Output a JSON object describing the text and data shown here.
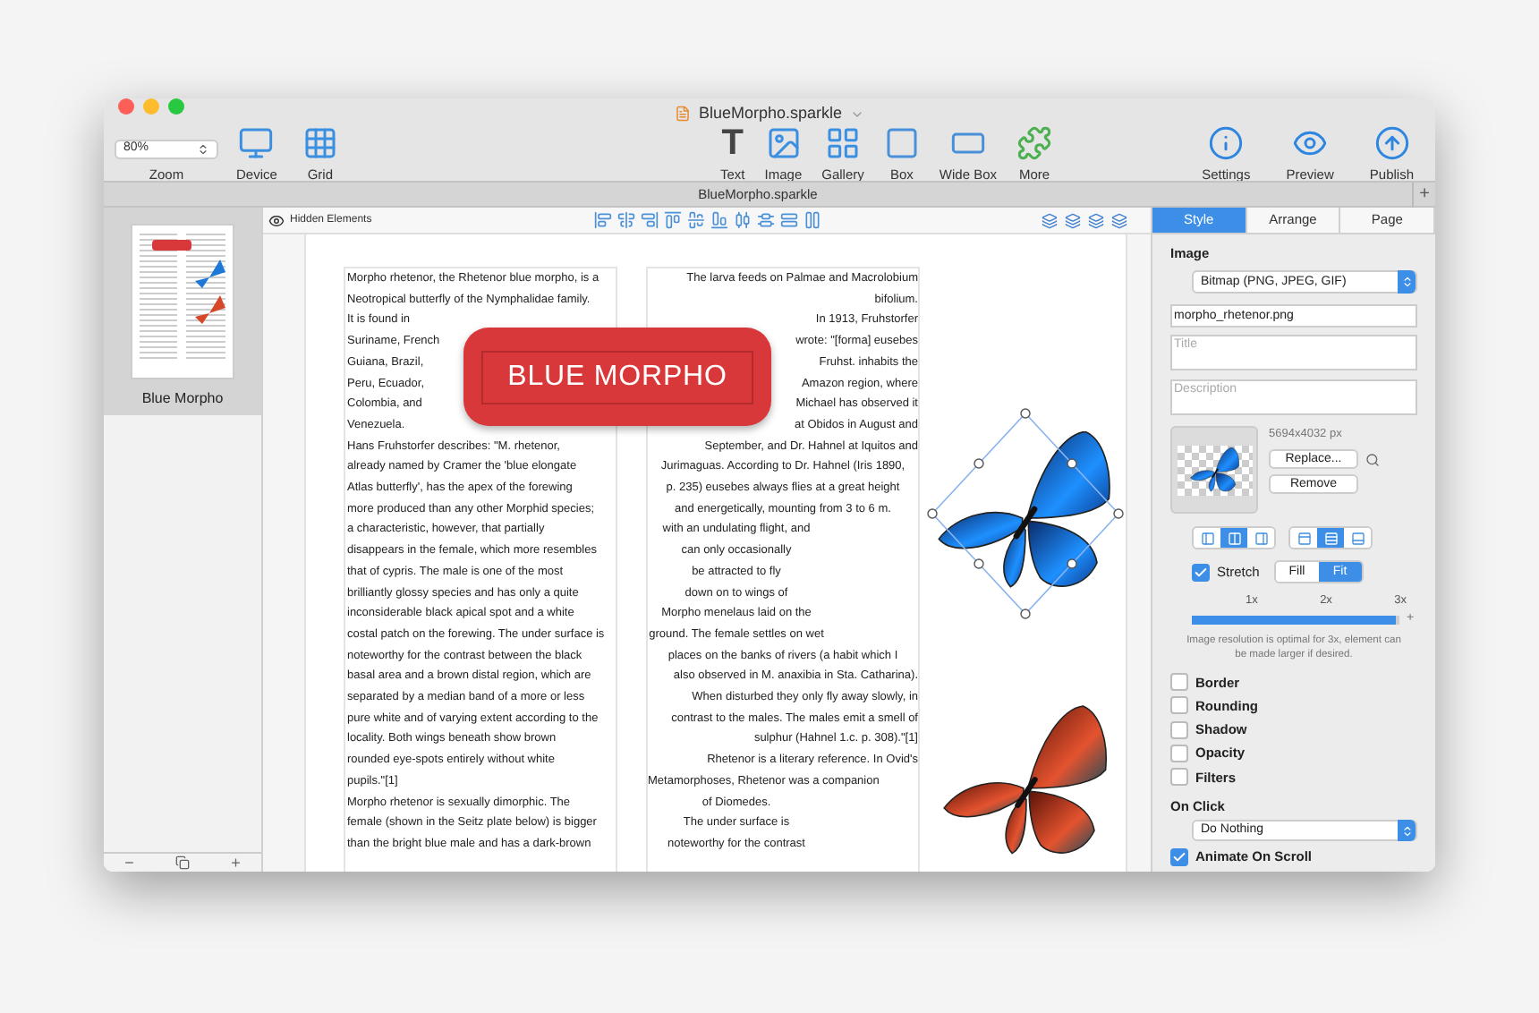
{
  "window": {
    "title": "BlueMorpho.sparkle"
  },
  "toolbar": {
    "zoom": {
      "value": "80%",
      "label": "Zoom"
    },
    "left": [
      {
        "kind": "device",
        "label": "Device"
      },
      {
        "kind": "grid",
        "label": "Grid"
      }
    ],
    "center": [
      {
        "kind": "text",
        "label": "Text",
        "glyph": "T"
      },
      {
        "kind": "image",
        "label": "Image"
      },
      {
        "kind": "gallery",
        "label": "Gallery"
      },
      {
        "kind": "box",
        "label": "Box"
      },
      {
        "kind": "widebox",
        "label": "Wide Box"
      },
      {
        "kind": "more",
        "label": "More"
      }
    ],
    "right": [
      {
        "kind": "settings",
        "label": "Settings"
      },
      {
        "kind": "preview",
        "label": "Preview"
      },
      {
        "kind": "publish",
        "label": "Publish"
      }
    ]
  },
  "document_tab": {
    "label": "BlueMorpho.sparkle",
    "add": "+"
  },
  "sidebar": {
    "pages": [
      {
        "label": "Blue Morpho",
        "selected": true
      }
    ],
    "remove": "−",
    "add": "+"
  },
  "canvas_toolbar": {
    "hidden_elements": "Hidden Elements"
  },
  "page": {
    "banner": "BLUE MORPHO",
    "column_1": [
      "Morpho rhetenor, the Rhetenor blue morpho, is a",
      "Neotropical butterfly of the Nymphalidae family.",
      "It is found in",
      "Suriname, French",
      "Guiana, Brazil,",
      "Peru, Ecuador,",
      "Colombia, and",
      "Venezuela.",
      "Hans Fruhstorfer describes: \"M. rhetenor,",
      "already named by Cramer the 'blue elongate",
      "Atlas butterfly', has the apex of the forewing",
      "more produced than any other Morphid species;",
      "a characteristic, however, that partially",
      "disappears in the female, which more resembles",
      "that of cypris. The male is one of the most",
      "brilliantly glossy species and has only a quite",
      "inconsiderable black apical spot and a white",
      "costal patch on the forewing. The under surface is",
      "noteworthy for the contrast between the black",
      "basal area and a brown distal region, which are",
      "separated by a median band of a more or less",
      "pure white and of varying extent according to the",
      "locality. Both wings beneath show brown",
      "rounded eye-spots entirely without white",
      "pupils.\"[1]",
      "Morpho rhetenor is sexually dimorphic. The",
      "female (shown in the Seitz plate below) is bigger",
      "than the bright blue male and has a dark-brown"
    ],
    "column_2": [
      {
        "text": "The larva feeds on Palmae and Macrolobium",
        "kind": "right"
      },
      {
        "text": "bifolium.",
        "kind": "right"
      },
      {
        "text": "In 1913, Fruhstorfer",
        "kind": "right"
      },
      {
        "text": "wrote: \"[forma] eusebes",
        "kind": "right"
      },
      {
        "text": "Fruhst. inhabits the",
        "kind": "right"
      },
      {
        "text": "Amazon region, where",
        "kind": "right"
      },
      {
        "text": "Michael has observed it",
        "kind": "right"
      },
      {
        "text": "at Obidos in August and",
        "kind": "right"
      },
      {
        "text": "September, and Dr. Hahnel at Iquitos and",
        "kind": "right"
      },
      {
        "text": "Jurimaguas. According to Dr. Hahnel (Iris 1890,",
        "kind": "center"
      },
      {
        "text": "p. 235) eusebes always flies at a great height",
        "kind": "center"
      },
      {
        "text": "and energetically, mounting from 3 to 6 m.",
        "kind": "center"
      },
      {
        "text": "with an undulating flight, and",
        "kind": "wrap"
      },
      {
        "text": "can only occasionally",
        "kind": "wrap"
      },
      {
        "text": "be attracted to fly",
        "kind": "wrap"
      },
      {
        "text": "down on to wings of",
        "kind": "wrap"
      },
      {
        "text": "Morpho menelaus laid on the",
        "kind": "wrap"
      },
      {
        "text": "ground. The female settles on wet",
        "kind": "wrap"
      },
      {
        "text": "places on the banks of rivers (a habit which I",
        "kind": "center"
      },
      {
        "text": "also observed in M. anaxibia in Sta. Catharina).",
        "kind": "right"
      },
      {
        "text": "When disturbed they only fly away slowly, in",
        "kind": "right"
      },
      {
        "text": "contrast to the males. The males emit a smell of",
        "kind": "right"
      },
      {
        "text": "sulphur (Hahnel 1.c. p. 308).\"[1]",
        "kind": "right"
      },
      {
        "text": "Rhetenor is a literary reference. In Ovid's",
        "kind": "right"
      },
      {
        "text": "Metamorphoses, Rhetenor was a companion",
        "kind": "wrap"
      },
      {
        "text": "of Diomedes.",
        "kind": "wrap"
      },
      {
        "text": "The under surface is",
        "kind": "wrap"
      },
      {
        "text": "noteworthy for the contrast",
        "kind": "wrap"
      }
    ]
  },
  "inspector": {
    "tabs": [
      {
        "label": "Style",
        "selected": true
      },
      {
        "label": "Arrange",
        "selected": false
      },
      {
        "label": "Page",
        "selected": false
      }
    ],
    "section": "Image",
    "type_select": "Bitmap (PNG, JPEG, GIF)",
    "file_name": "morpho_rhetenor.png",
    "title": {
      "placeholder": "Title"
    },
    "description": {
      "placeholder": "Description"
    },
    "dimensions": "5694x4032 px",
    "replace": "Replace...",
    "remove": "Remove",
    "horizontal_position": [
      {
        "selected": false
      },
      {
        "selected": true
      },
      {
        "selected": false
      }
    ],
    "vertical_position": [
      {
        "selected": false
      },
      {
        "selected": true
      },
      {
        "selected": false
      }
    ],
    "stretch": {
      "label": "Stretch",
      "checked": true
    },
    "fit_mode": [
      {
        "label": "Fill",
        "selected": false
      },
      {
        "label": "Fit",
        "selected": true
      }
    ],
    "scale_slider": {
      "ticks": [
        "1x",
        "2x",
        "3x"
      ],
      "level": 0.98,
      "plus": "+"
    },
    "resolution_note": "Image resolution is optimal for 3x, element can be made larger if desired.",
    "effects": [
      {
        "label": "Border",
        "checked": false
      },
      {
        "label": "Rounding",
        "checked": false
      },
      {
        "label": "Shadow",
        "checked": false
      },
      {
        "label": "Opacity",
        "checked": false
      },
      {
        "label": "Filters",
        "checked": false
      }
    ],
    "on_click": {
      "label": "On Click",
      "value": "Do Nothing"
    },
    "animate": {
      "label": "Animate On Scroll",
      "checked": true
    }
  }
}
